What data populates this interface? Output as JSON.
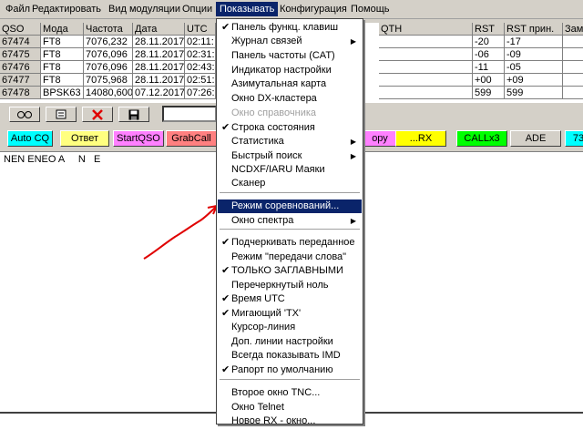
{
  "menubar": [
    "Файл",
    "Редактировать",
    "Вид модуляции",
    "Опции",
    "Показывать",
    "Конфигурация",
    "Помощь"
  ],
  "columns": [
    "QSO",
    "Мода",
    "Частота",
    "Дата",
    "UTC",
    "QTH",
    "RST",
    "RST прин.",
    "Зам"
  ],
  "rows": [
    [
      "67474",
      "FT8",
      "7076,232",
      "28.11.2017",
      "02:11:",
      "",
      "-20",
      "-17",
      ""
    ],
    [
      "67475",
      "FT8",
      "7076,096",
      "28.11.2017",
      "02:31:3",
      "",
      "-06",
      "-09",
      ""
    ],
    [
      "67476",
      "FT8",
      "7076,096",
      "28.11.2017",
      "02:43:4",
      "",
      "-11",
      "-05",
      ""
    ],
    [
      "67477",
      "FT8",
      "7075,968",
      "28.11.2017",
      "02:51:3",
      "",
      "+00",
      "+09",
      ""
    ],
    [
      "67478",
      "BPSK63",
      "14080,600",
      "07.12.2017",
      "07:26:0",
      "",
      "599",
      "599",
      ""
    ]
  ],
  "fkeys": [
    {
      "label": "Auto CQ",
      "color": "#00ffff"
    },
    {
      "label": "Ответ",
      "color": "#ffff80"
    },
    {
      "label": "StartQSO",
      "color": "#ff80ff"
    },
    {
      "label": "GrabCall",
      "color": "#ff8080"
    },
    {
      "label": "ору",
      "color": "#ff80ff"
    },
    {
      "label": "...RX",
      "color": "#ffff00"
    },
    {
      "label": "CALLx3",
      "color": "#00ff00"
    },
    {
      "label": "ADE",
      "color": "#d4d0c8"
    },
    {
      "label": "73",
      "color": "#00ffff"
    }
  ],
  "rx_text": "NEN ENEO A     N   E",
  "menu": {
    "items": [
      {
        "label": "Панель функц. клавиш",
        "checked": true,
        "submenu": false,
        "disabled": false
      },
      {
        "label": "Журнал связей",
        "checked": false,
        "submenu": true,
        "disabled": false
      },
      {
        "label": "Панель частоты (CAT)",
        "checked": false,
        "submenu": false,
        "disabled": false
      },
      {
        "label": "Индикатор настройки",
        "checked": false,
        "submenu": false,
        "disabled": false
      },
      {
        "label": "Азимутальная карта",
        "checked": false,
        "submenu": false,
        "disabled": false
      },
      {
        "label": "Окно DX-кластера",
        "checked": false,
        "submenu": false,
        "disabled": false
      },
      {
        "label": "Окно справочника",
        "checked": false,
        "submenu": false,
        "disabled": true
      },
      {
        "label": "Строка состояния",
        "checked": true,
        "submenu": false,
        "disabled": false
      },
      {
        "label": "Статистика",
        "checked": false,
        "submenu": true,
        "disabled": false
      },
      {
        "label": "Быстрый поиск",
        "checked": false,
        "submenu": true,
        "disabled": false
      },
      {
        "label": "NCDXF/IARU Маяки",
        "checked": false,
        "submenu": false,
        "disabled": false
      },
      {
        "label": "Сканер",
        "checked": false,
        "submenu": false,
        "disabled": false
      },
      {
        "label": "Режим соревнований...",
        "checked": false,
        "submenu": false,
        "disabled": false,
        "highlighted": true
      },
      {
        "label": "Окно спектра",
        "checked": false,
        "submenu": true,
        "disabled": false
      },
      {
        "label": "Подчеркивать переданное",
        "checked": true,
        "submenu": false,
        "disabled": false
      },
      {
        "label": "Режим \"передачи слова\"",
        "checked": false,
        "submenu": false,
        "disabled": false
      },
      {
        "label": "ТОЛЬКО ЗАГЛАВНЫМИ",
        "checked": true,
        "submenu": false,
        "disabled": false
      },
      {
        "label": "Перечеркнутый ноль",
        "checked": false,
        "submenu": false,
        "disabled": false
      },
      {
        "label": "Время UTC",
        "checked": true,
        "submenu": false,
        "disabled": false
      },
      {
        "label": "Мигающий 'TX'",
        "checked": true,
        "submenu": false,
        "disabled": false
      },
      {
        "label": "Курсор-линия",
        "checked": false,
        "submenu": false,
        "disabled": false
      },
      {
        "label": "Доп. линии настройки",
        "checked": false,
        "submenu": false,
        "disabled": false
      },
      {
        "label": "Всегда показывать IMD",
        "checked": false,
        "submenu": false,
        "disabled": false
      },
      {
        "label": "Рапорт по умолчанию",
        "checked": true,
        "submenu": false,
        "disabled": false
      },
      {
        "label": "Второе окно TNC...",
        "checked": false,
        "submenu": false,
        "disabled": false
      },
      {
        "label": "Окно Telnet",
        "checked": false,
        "submenu": false,
        "disabled": false
      },
      {
        "label": "Новое RX - окно...",
        "checked": false,
        "submenu": false,
        "disabled": false
      }
    ]
  },
  "colors": {
    "highlight": "#0a246a",
    "annotation_arrow": "#e00000"
  },
  "icons": [
    "glasses-icon",
    "notepad-icon",
    "delete-x-icon",
    "save-disk-icon",
    "check-icon",
    "submenu-arrow-icon"
  ]
}
